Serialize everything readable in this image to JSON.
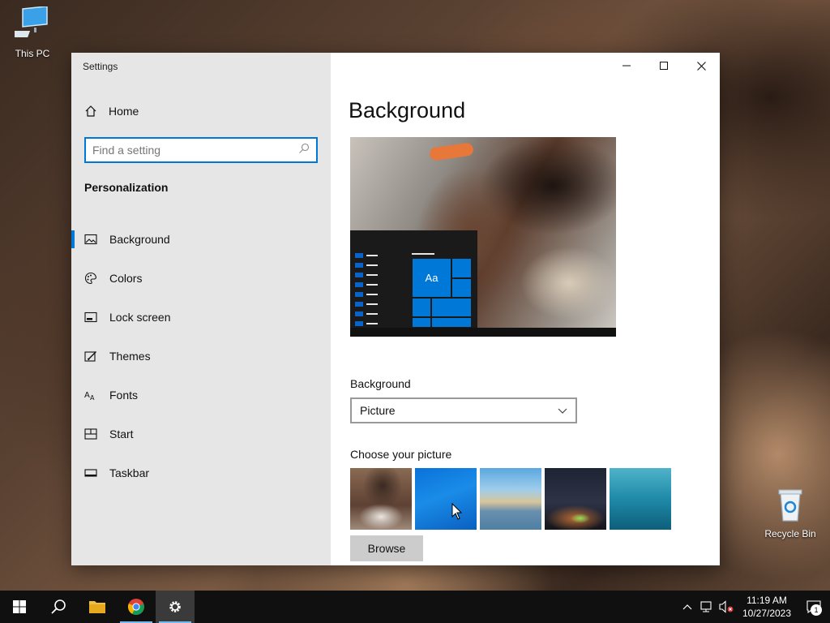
{
  "desktop": {
    "icons": [
      {
        "label": "This PC"
      },
      {
        "label": "Recycle Bin"
      }
    ]
  },
  "window": {
    "title": "Settings",
    "sidebar": {
      "home_label": "Home",
      "search_placeholder": "Find a setting",
      "section_title": "Personalization",
      "items": [
        {
          "label": "Background",
          "icon": "picture-icon",
          "active": true
        },
        {
          "label": "Colors",
          "icon": "palette-icon",
          "active": false
        },
        {
          "label": "Lock screen",
          "icon": "lock-screen-icon",
          "active": false
        },
        {
          "label": "Themes",
          "icon": "themes-icon",
          "active": false
        },
        {
          "label": "Fonts",
          "icon": "fonts-icon",
          "active": false
        },
        {
          "label": "Start",
          "icon": "start-icon",
          "active": false
        },
        {
          "label": "Taskbar",
          "icon": "taskbar-icon",
          "active": false
        }
      ]
    },
    "content": {
      "page_title": "Background",
      "preview_tile_text": "Aa",
      "background_label": "Background",
      "background_value": "Picture",
      "choose_label": "Choose your picture",
      "browse_label": "Browse"
    }
  },
  "taskbar": {
    "time": "11:19 AM",
    "date": "10/27/2023",
    "notification_count": "1"
  },
  "colors": {
    "accent": "#0078d7",
    "sidebar_bg": "#e6e6e6",
    "taskbar_bg": "#101010"
  }
}
